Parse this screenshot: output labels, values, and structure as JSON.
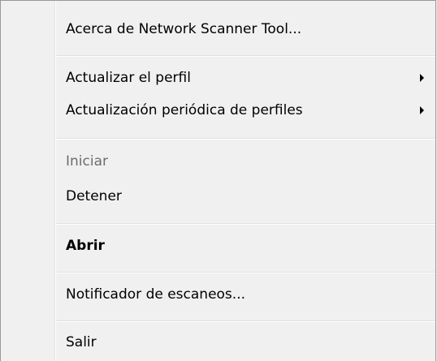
{
  "menu": {
    "items": [
      {
        "label": "Acerca de Network Scanner Tool..."
      },
      {
        "label": "Actualizar el perfil",
        "submenu_icon": "submenu-arrow-icon"
      },
      {
        "label": "Actualización periódica de perfiles",
        "submenu_icon": "submenu-arrow-icon"
      },
      {
        "label": "Iniciar",
        "disabled": true
      },
      {
        "label": "Detener"
      },
      {
        "label": "Abrir",
        "default": true
      },
      {
        "label": "Notificador de escaneos..."
      },
      {
        "label": "Salir"
      }
    ]
  }
}
